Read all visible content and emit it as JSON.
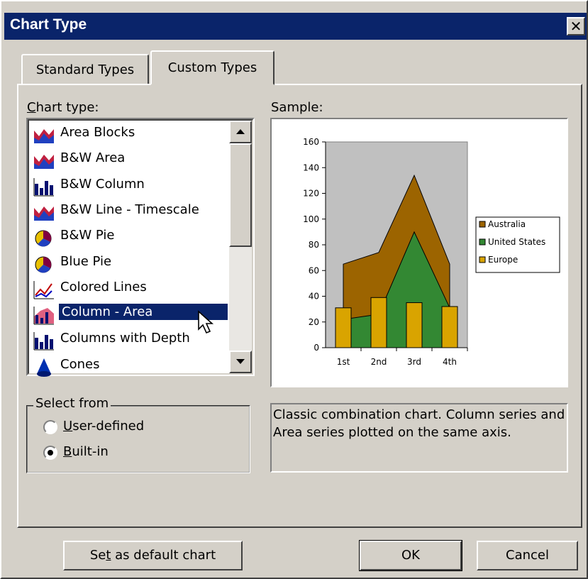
{
  "window": {
    "title": "Chart Type",
    "close_symbol": "✕"
  },
  "tabs": [
    {
      "label": "Standard Types",
      "selected": false
    },
    {
      "label": "Custom Types",
      "selected": true
    }
  ],
  "chart_type_label": {
    "prefix": "C",
    "rest": "hart type:"
  },
  "chart_types": [
    {
      "label": "Area Blocks",
      "icon": "area-chart-icon"
    },
    {
      "label": "B&W Area",
      "icon": "area-chart-icon"
    },
    {
      "label": "B&W Column",
      "icon": "column-chart-icon"
    },
    {
      "label": "B&W Line - Timescale",
      "icon": "area-chart-icon"
    },
    {
      "label": "B&W Pie",
      "icon": "pie-chart-icon"
    },
    {
      "label": "Blue Pie",
      "icon": "pie-chart-icon"
    },
    {
      "label": "Colored Lines",
      "icon": "line-chart-icon"
    },
    {
      "label": "Column - Area",
      "icon": "column-area-chart-icon",
      "selected": true
    },
    {
      "label": "Columns with Depth",
      "icon": "column-chart-icon"
    },
    {
      "label": "Cones",
      "icon": "cone-chart-icon"
    }
  ],
  "select_from": {
    "title": "Select from",
    "options": [
      {
        "prefix": "U",
        "rest": "ser-defined",
        "checked": false
      },
      {
        "prefix": "B",
        "rest": "uilt-in",
        "checked": true
      }
    ]
  },
  "sample_label": "Sample:",
  "description": "Classic combination chart. Column series and Area series plotted on the same axis.",
  "buttons": {
    "set_default": {
      "pre": "Se",
      "ul": "t",
      "post": " as default chart"
    },
    "ok": "OK",
    "cancel": "Cancel"
  },
  "colors": {
    "titlebar": "#0a246a",
    "selection": "#0a246a",
    "face": "#d4d0c8",
    "australia": "#9c6400",
    "united_states": "#338833",
    "europe": "#d9a400",
    "plot_bg": "#c0c0c0"
  },
  "chart_data": {
    "type": "area",
    "categories": [
      "1st",
      "2nd",
      "3rd",
      "4th"
    ],
    "y_ticks": [
      0,
      20,
      40,
      60,
      80,
      100,
      120,
      140,
      160
    ],
    "ylim": [
      0,
      160
    ],
    "series": [
      {
        "name": "Australia",
        "kind": "area",
        "values": [
          65,
          74,
          134,
          65
        ]
      },
      {
        "name": "United States",
        "kind": "area",
        "values": [
          22,
          26,
          90,
          31
        ]
      },
      {
        "name": "Europe",
        "kind": "column",
        "values": [
          31,
          39,
          35,
          32
        ]
      }
    ],
    "legend": [
      "Australia",
      "United States",
      "Europe"
    ],
    "legend_position": "right",
    "grid": false
  }
}
